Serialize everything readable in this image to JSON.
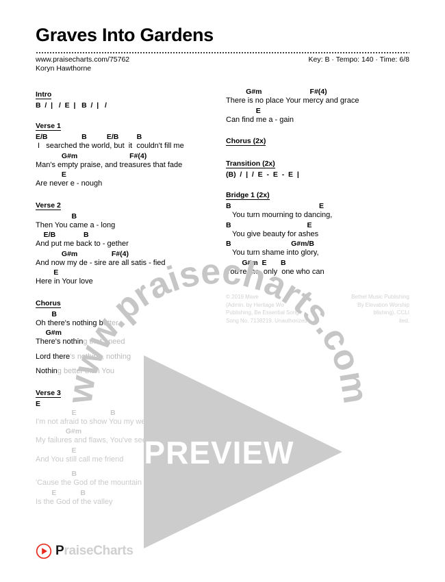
{
  "header": {
    "title": "Graves Into Gardens",
    "url": "www.praisecharts.com/75762",
    "artist": "Koryn Hawthorne",
    "meta": "Key: B · Tempo: 140 · Time: 6/8"
  },
  "left_column": [
    {
      "heading": "Intro",
      "lines": [
        {
          "type": "chord",
          "text": "B  /  |   /  E  |   B  /  |   /"
        }
      ]
    },
    {
      "heading": "Verse 1",
      "lines": [
        {
          "type": "chord",
          "text": "E/B                 B          E/B         B"
        },
        {
          "type": "lyric",
          "text": " I   searched the world, but  it  couldn't fill me"
        },
        {
          "type": "chord",
          "text": "             G#m                          F#(4)"
        },
        {
          "type": "lyric",
          "text": "Man's empty praise, and treasures that fade"
        },
        {
          "type": "chord",
          "text": "             E"
        },
        {
          "type": "lyric",
          "text": "Are never e - nough"
        }
      ]
    },
    {
      "heading": "Verse 2",
      "lines": [
        {
          "type": "chord",
          "text": "                  B"
        },
        {
          "type": "lyric",
          "text": "Then You came a - long"
        },
        {
          "type": "chord",
          "text": "    E/B              B"
        },
        {
          "type": "lyric",
          "text": "And put me back to - gether"
        },
        {
          "type": "chord",
          "text": "             G#m                 F#(4)"
        },
        {
          "type": "lyric",
          "text": "And now my de - sire are all satis - fied"
        },
        {
          "type": "chord",
          "text": "         E"
        },
        {
          "type": "lyric",
          "text": "Here in Your love"
        }
      ]
    },
    {
      "heading": "Chorus",
      "lines": [
        {
          "type": "chord",
          "text": "        B"
        },
        {
          "type": "lyric",
          "text": "Oh there's nothing b",
          "faded_tail": "etter"
        },
        {
          "type": "chord",
          "text": "     G#m"
        },
        {
          "type": "lyric",
          "text": "There's nothin",
          "faded_tail": "g that I need"
        },
        {
          "type": "spacer"
        },
        {
          "type": "lyric",
          "text": "Lord there",
          "faded_tail": "'s nothing, nothing"
        },
        {
          "type": "spacer"
        },
        {
          "type": "lyric",
          "text": "Nothin",
          "faded_tail": "g better than You"
        }
      ]
    },
    {
      "heading": "Verse 3",
      "heading_occluded": true,
      "lines": [
        {
          "type": "chord",
          "text": "E"
        },
        {
          "type": "chord_faded",
          "text": "                  E                 B"
        },
        {
          "type": "lyric_faded",
          "text": "I'm not afraid to show You my weakness"
        },
        {
          "type": "chord_faded",
          "text": "               G#m"
        },
        {
          "type": "lyric_faded",
          "text": "My failures and flaws, You've seen them all"
        },
        {
          "type": "chord_faded",
          "text": "                  E"
        },
        {
          "type": "lyric_faded",
          "text": "And You still call me friend"
        },
        {
          "type": "spacer"
        },
        {
          "type": "chord_faded",
          "text": "                  B"
        },
        {
          "type": "lyric_faded",
          "text": "'Cause the God of the mountain"
        },
        {
          "type": "chord_faded",
          "text": "        E            B"
        },
        {
          "type": "lyric_faded",
          "text": "Is the God of the valley"
        }
      ]
    }
  ],
  "right_column": [
    {
      "heading": "",
      "lines": [
        {
          "type": "chord",
          "text": "          G#m                        F#(4)"
        },
        {
          "type": "lyric",
          "text": "There is no place Your mercy and grace"
        },
        {
          "type": "chord",
          "text": "               E"
        },
        {
          "type": "lyric",
          "text": "Can find me a - gain"
        }
      ]
    },
    {
      "heading": "Chorus (2x)",
      "lines": []
    },
    {
      "heading": "Transition (2x)",
      "lines": [
        {
          "type": "chord",
          "text": "(B)  /  |  /  E  -  E  -  E  |"
        }
      ]
    },
    {
      "heading": "Bridge 1 (2x)",
      "lines": [
        {
          "type": "chord",
          "text": "B                                            E"
        },
        {
          "type": "lyric",
          "text": "   You turn mourning to dancing,"
        },
        {
          "type": "chord",
          "text": "B                                      E"
        },
        {
          "type": "lyric",
          "text": "   You give beauty for ashes"
        },
        {
          "type": "chord",
          "text": "B                              G#m/B"
        },
        {
          "type": "lyric",
          "text": "   You turn shame into glory,"
        },
        {
          "type": "chord",
          "text": "        G#m  E       B"
        },
        {
          "type": "lyric",
          "text": "You're the  only  one who can"
        }
      ]
    }
  ],
  "copyright": {
    "line1": "© 2019 Mave",
    "line2": "(Admin. by Heritage Wo",
    "line3": "Publishing, Be Essential Song",
    "line4": "Song No. 7138219. Unauthorized",
    "right1": "Bethel Music Publishing",
    "right2": "By Elevation Worship",
    "right3": "blishing). CCLI",
    "right4": "ited."
  },
  "watermark": {
    "ring_text": "www.praisecharts.com",
    "preview_label": "PREVIEW",
    "ring_color": "#c6c6c6",
    "overlay_color": "#cccccc"
  },
  "logo": {
    "lead": "P",
    "rest": "raiseCharts",
    "accent_color": "#e8291c"
  }
}
